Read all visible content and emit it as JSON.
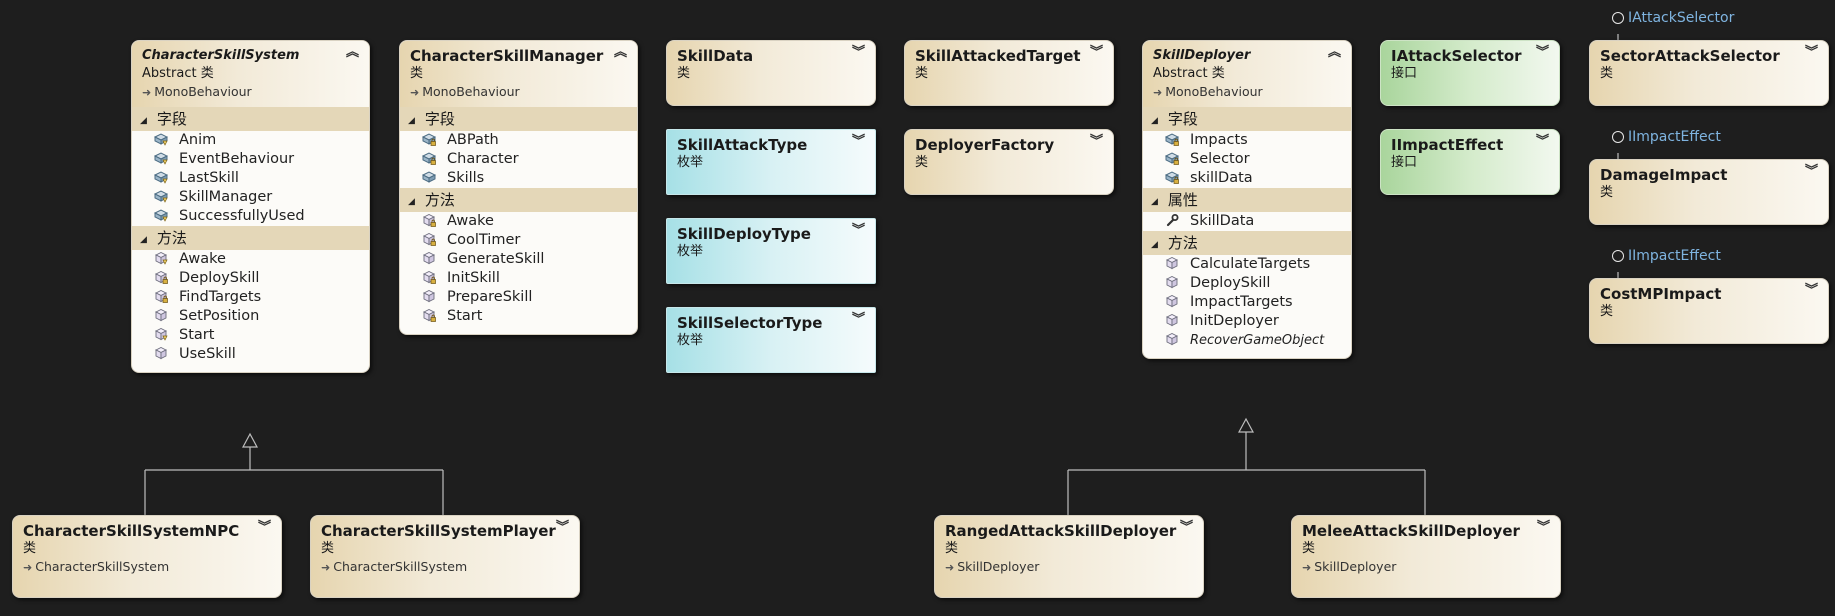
{
  "diagram": {
    "interface_labels": [
      {
        "id": "lolli-attack-selector",
        "text": "IAttackSelector"
      },
      {
        "id": "lolli-damage-impact",
        "text": "IImpactEffect"
      },
      {
        "id": "lolli-costmp-impact",
        "text": "IImpactEffect"
      }
    ],
    "boxes": [
      {
        "id": "CharacterSkillSystem",
        "name": "CharacterSkillSystem",
        "abstract": true,
        "kind": "Abstract 类",
        "base": "MonoBehaviour",
        "style": "class",
        "sections": [
          {
            "title": "字段",
            "members": [
              {
                "name": "Anim",
                "icon": "field-protected-icon"
              },
              {
                "name": "EventBehaviour",
                "icon": "field-protected-icon"
              },
              {
                "name": "LastSkill",
                "icon": "field-protected-icon"
              },
              {
                "name": "SkillManager",
                "icon": "field-protected-icon"
              },
              {
                "name": "SuccessfullyUsed",
                "icon": "field-protected-icon"
              }
            ]
          },
          {
            "title": "方法",
            "members": [
              {
                "name": "Awake",
                "icon": "method-protected-icon"
              },
              {
                "name": "DeploySkill",
                "icon": "method-private-icon"
              },
              {
                "name": "FindTargets",
                "icon": "method-private-icon"
              },
              {
                "name": "SetPosition",
                "icon": "method-icon"
              },
              {
                "name": "Start",
                "icon": "method-protected-icon"
              },
              {
                "name": "UseSkill",
                "icon": "method-icon"
              }
            ]
          }
        ]
      },
      {
        "id": "CharacterSkillManager",
        "name": "CharacterSkillManager",
        "abstract": false,
        "kind": "类",
        "base": "MonoBehaviour",
        "style": "class",
        "sections": [
          {
            "title": "字段",
            "members": [
              {
                "name": "ABPath",
                "icon": "field-private-icon"
              },
              {
                "name": "Character",
                "icon": "field-private-icon"
              },
              {
                "name": "Skills",
                "icon": "field-icon"
              }
            ]
          },
          {
            "title": "方法",
            "members": [
              {
                "name": "Awake",
                "icon": "method-private-icon"
              },
              {
                "name": "CoolTimer",
                "icon": "method-private-icon"
              },
              {
                "name": "GenerateSkill",
                "icon": "method-icon"
              },
              {
                "name": "InitSkill",
                "icon": "method-private-icon"
              },
              {
                "name": "PrepareSkill",
                "icon": "method-icon"
              },
              {
                "name": "Start",
                "icon": "method-private-icon"
              }
            ]
          }
        ]
      },
      {
        "id": "SkillData",
        "name": "SkillData",
        "kind": "类",
        "style": "class"
      },
      {
        "id": "SkillAttackType",
        "name": "SkillAttackType",
        "kind": "枚举",
        "style": "enum"
      },
      {
        "id": "SkillDeployType",
        "name": "SkillDeployType",
        "kind": "枚举",
        "style": "enum"
      },
      {
        "id": "SkillSelectorType",
        "name": "SkillSelectorType",
        "kind": "枚举",
        "style": "enum"
      },
      {
        "id": "SkillAttackedTarget",
        "name": "SkillAttackedTarget",
        "kind": "类",
        "style": "class"
      },
      {
        "id": "DeployerFactory",
        "name": "DeployerFactory",
        "kind": "类",
        "style": "class"
      },
      {
        "id": "SkillDeployer",
        "name": "SkillDeployer",
        "abstract": true,
        "kind": "Abstract 类",
        "base": "MonoBehaviour",
        "style": "class",
        "sections": [
          {
            "title": "字段",
            "members": [
              {
                "name": "Impacts",
                "icon": "field-private-icon"
              },
              {
                "name": "Selector",
                "icon": "field-private-icon"
              },
              {
                "name": "skillData",
                "icon": "field-private-icon"
              }
            ]
          },
          {
            "title": "属性",
            "members": [
              {
                "name": "SkillData",
                "icon": "wrench-icon"
              }
            ]
          },
          {
            "title": "方法",
            "members": [
              {
                "name": "CalculateTargets",
                "icon": "method-icon"
              },
              {
                "name": "DeploySkill",
                "icon": "method-icon"
              },
              {
                "name": "ImpactTargets",
                "icon": "method-icon"
              },
              {
                "name": "InitDeployer",
                "icon": "method-icon"
              },
              {
                "name": "RecoverGameObject",
                "icon": "method-icon",
                "italic": true
              }
            ]
          }
        ]
      },
      {
        "id": "IAttackSelector",
        "name": "IAttackSelector",
        "kind": "接口",
        "style": "iface"
      },
      {
        "id": "IImpactEffect",
        "name": "IImpactEffect",
        "kind": "接口",
        "style": "iface"
      },
      {
        "id": "SectorAttackSelector",
        "name": "SectorAttackSelector",
        "kind": "类",
        "style": "class"
      },
      {
        "id": "DamageImpact",
        "name": "DamageImpact",
        "kind": "类",
        "style": "class"
      },
      {
        "id": "CostMPImpact",
        "name": "CostMPImpact",
        "kind": "类",
        "style": "class"
      },
      {
        "id": "CharacterSkillSystemNPC",
        "name": "CharacterSkillSystemNPC",
        "kind": "类",
        "base": "CharacterSkillSystem",
        "style": "class"
      },
      {
        "id": "CharacterSkillSystemPlayer",
        "name": "CharacterSkillSystemPlayer",
        "kind": "类",
        "base": "CharacterSkillSystem",
        "style": "class"
      },
      {
        "id": "RangedAttackSkillDeployer",
        "name": "RangedAttackSkillDeployer",
        "kind": "类",
        "base": "SkillDeployer",
        "style": "class"
      },
      {
        "id": "MeleeAttackSkillDeployer",
        "name": "MeleeAttackSkillDeployer",
        "kind": "类",
        "base": "SkillDeployer",
        "style": "class"
      }
    ]
  }
}
